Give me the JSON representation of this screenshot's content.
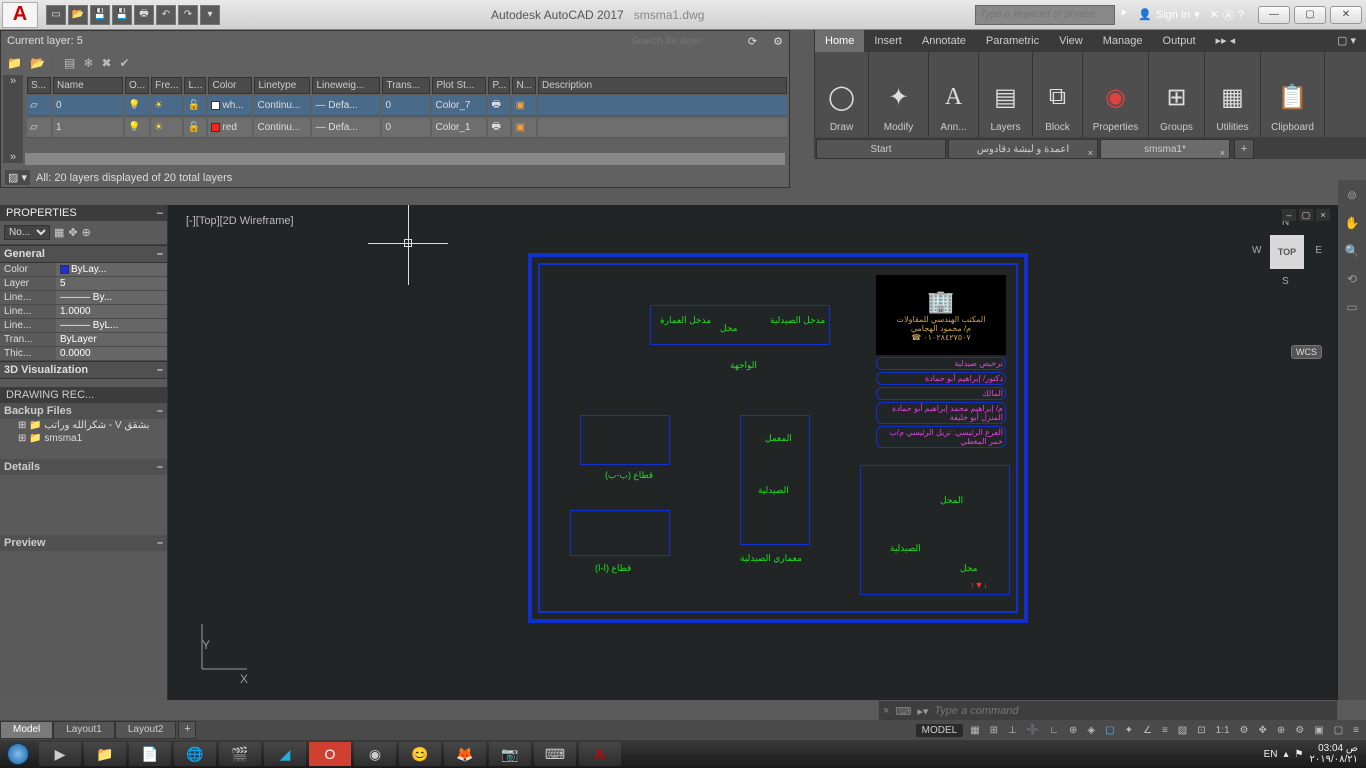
{
  "titlebar": {
    "app_name": "Autodesk AutoCAD 2017",
    "file_name": "smsma1.dwg",
    "search_placeholder": "Type a keyword or phrase",
    "signin": "Sign In"
  },
  "ribbon": {
    "tabs": [
      "Home",
      "Insert",
      "Annotate",
      "Parametric",
      "View",
      "Manage",
      "Output"
    ],
    "panels": [
      {
        "label": "Draw",
        "icon": "◯"
      },
      {
        "label": "Modify",
        "icon": "✦"
      },
      {
        "label": "Ann...",
        "icon": "A"
      },
      {
        "label": "Layers",
        "icon": "▤"
      },
      {
        "label": "Block",
        "icon": "⧉"
      },
      {
        "label": "Properties",
        "icon": "◉"
      },
      {
        "label": "Groups",
        "icon": "⊞"
      },
      {
        "label": "Utilities",
        "icon": "▦"
      },
      {
        "label": "Clipboard",
        "icon": "📋"
      }
    ]
  },
  "doc_tabs": {
    "start": "Start",
    "tab1": "اعمدة و لبشة دقادوس",
    "tab2": "smsma1*"
  },
  "layer_panel": {
    "title": "Current layer: 5",
    "search_placeholder": "Search for layer",
    "headers": [
      "S...",
      "Name",
      "O...",
      "Fre...",
      "L...",
      "Color",
      "Linetype",
      "Lineweig...",
      "Trans...",
      "Plot St...",
      "P...",
      "N...",
      "Description"
    ],
    "rows": [
      {
        "name": "0",
        "color": "wh...",
        "ltype": "Continu...",
        "lweight": "— Defa...",
        "trans": "0",
        "plot": "Color_7"
      },
      {
        "name": "1",
        "color": "red",
        "ltype": "Continu...",
        "lweight": "— Defa...",
        "trans": "0",
        "plot": "Color_1"
      }
    ],
    "footer": "All: 20 layers displayed of 20 total layers"
  },
  "properties": {
    "title": "PROPERTIES",
    "selector": "No...",
    "general": "General",
    "rows": [
      {
        "k": "Color",
        "v": "ByLay..."
      },
      {
        "k": "Layer",
        "v": "5"
      },
      {
        "k": "Line...",
        "v": "——— By..."
      },
      {
        "k": "Line...",
        "v": "1.0000"
      },
      {
        "k": "Line...",
        "v": "——— ByL..."
      },
      {
        "k": "Tran...",
        "v": "ByLayer"
      },
      {
        "k": "Thic...",
        "v": "0.0000"
      }
    ],
    "viz3d": "3D Visualization",
    "rec_title": "DRAWING REC...",
    "backup_title": "Backup Files",
    "backup_items": [
      "شكرالله وراتب - V بشقق",
      "smsma1"
    ],
    "details": "Details",
    "preview": "Preview"
  },
  "canvas": {
    "view_label": "[-][Top][2D Wireframe]",
    "viewcube": "TOP",
    "wcs": "WCS",
    "ucs_x": "X",
    "ucs_y": "Y",
    "labels": {
      "l1": "مدخل العمارة",
      "l2": "محل",
      "l3": "مدخل الصيدلية",
      "l4": "الواجهة",
      "l5": "قطاع (ب-ب)",
      "l6": "المعمل",
      "l7": "الصيدلية",
      "l8": "معماري الصيدلية",
      "l9": "قطاع (ا-ا)",
      "l10": "المحل",
      "l11": "الصيدلية",
      "l12": "محل",
      "tb1": "ترخيص صيدلية",
      "tb2": "دكتور/ إبراهيم أبو حمادة",
      "tb3": "المالك",
      "tb4": "م/ إبراهيم محمد إبراهيم أبو حمادة المنزل أبو خليفة",
      "tb5": "الفرع الرئيسي: تريل الرئيسي م/ب خمر المغطي"
    }
  },
  "cmdline": {
    "placeholder": "Type a command"
  },
  "layout_tabs": [
    "Model",
    "Layout1",
    "Layout2"
  ],
  "statusbar": {
    "model": "MODEL",
    "scale": "1:1"
  },
  "taskbar": {
    "lang": "EN",
    "time": "03:04 ص",
    "date": "٢٠١٩/٠٨/٢١"
  }
}
